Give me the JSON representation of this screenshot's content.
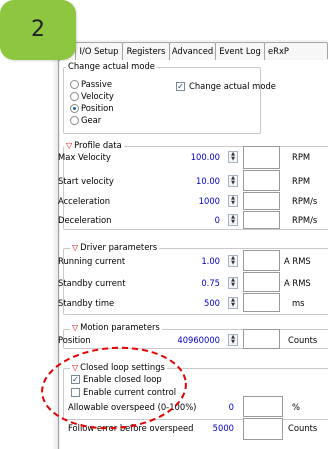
{
  "badge": {
    "number": "2",
    "color": "#8dc63f"
  },
  "tabs": [
    {
      "label": "n",
      "active": true
    },
    {
      "label": "I/O Setup",
      "active": false
    },
    {
      "label": "Registers",
      "active": false
    },
    {
      "label": "Advanced",
      "active": false
    },
    {
      "label": "Event Log",
      "active": false
    },
    {
      "label": "eRxP",
      "active": false
    }
  ],
  "mode": {
    "title": "Change actual mode",
    "options": [
      "Passive",
      "Velocity",
      "Position",
      "Gear"
    ],
    "selected": "Position",
    "change_checkbox_label": "Change actual mode",
    "change_checked": true
  },
  "profile": {
    "title": "Profile data",
    "rows": [
      {
        "label": "Max Velocity",
        "value": "100.00",
        "unit": "RPM"
      },
      {
        "label": "Start velocity",
        "value": "10.00",
        "unit": "RPM"
      },
      {
        "label": "Acceleration",
        "value": "1000",
        "unit": "RPM/s"
      },
      {
        "label": "Deceleration",
        "value": "0",
        "unit": "RPM/s"
      }
    ]
  },
  "driver": {
    "title": "Driver parameters",
    "rows": [
      {
        "label": "Running current",
        "value": "1.00",
        "unit": "A RMS"
      },
      {
        "label": "Standby current",
        "value": "0.75",
        "unit": "A RMS"
      },
      {
        "label": "Standby time",
        "value": "500",
        "unit": "ms"
      }
    ]
  },
  "motion": {
    "title": "Motion parameters",
    "position_label": "Position",
    "position_value": "40960000",
    "position_unit": "Counts"
  },
  "closed_loop": {
    "title": "Closed loop settings",
    "enable_closed_loop_label": "Enable closed loop",
    "enable_closed_loop_checked": true,
    "enable_current_control_label": "Enable current control",
    "enable_current_control_checked": false,
    "overspeed_label": "Allowable overspeed (0-100%)",
    "overspeed_value": "0",
    "overspeed_unit": "%",
    "follow_error_label": "Follow error before overspeed",
    "follow_error_value": "5000",
    "follow_error_unit": "Counts"
  },
  "colors": {
    "highlight_oval": "#e30000",
    "value_text": "#0000cc",
    "section_triangle": "#e00000"
  }
}
